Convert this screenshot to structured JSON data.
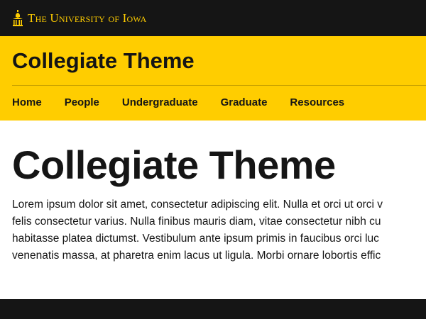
{
  "header": {
    "logo_text": "The University of Iowa",
    "logo_icon": "old-capitol-icon",
    "brand_colors": {
      "black": "#151515",
      "gold": "#FFCD00"
    }
  },
  "site": {
    "name": "Collegiate Theme"
  },
  "nav": {
    "items": [
      {
        "label": "Home"
      },
      {
        "label": "People"
      },
      {
        "label": "Undergraduate"
      },
      {
        "label": "Graduate"
      },
      {
        "label": "Resources"
      }
    ]
  },
  "main": {
    "title": "Collegiate Theme",
    "body_lines": [
      "Lorem ipsum dolor sit amet, consectetur adipiscing elit. Nulla et orci ut orci v",
      "felis consectetur varius. Nulla finibus mauris diam, vitae consectetur nibh cu",
      "habitasse platea dictumst. Vestibulum ante ipsum primis in faucibus orci luc",
      "venenatis massa, at pharetra enim lacus ut ligula. Morbi ornare lobortis effic"
    ]
  }
}
